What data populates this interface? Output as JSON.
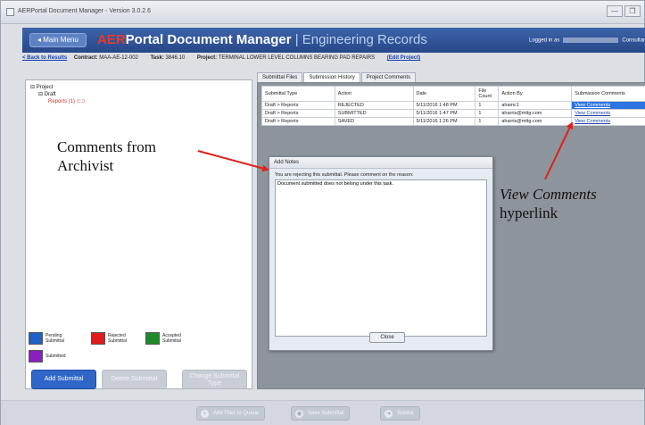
{
  "window": {
    "title": "AERPortal Document Manager - Version 3.0.2.6",
    "min_label": "—",
    "max_label": "❐"
  },
  "header": {
    "main_menu": "◂ Main Menu",
    "brand_prefix": "AER",
    "app_name": "Portal Document Manager",
    "separator": " | ",
    "section": "Engineering Records",
    "logged_in_prefix": "Logged in as",
    "role": "Consultant"
  },
  "infobar": {
    "back_link": "< Back to Results",
    "contract_label": "Contract:",
    "contract_value": "MAA-AE-12-002",
    "task_label": "Task:",
    "task_value": "3846.10",
    "project_label": "Project:",
    "project_value": "TERMINAL LOWER LEVEL COLUMNS BEARING PAD REPAIRS",
    "edit_link": "(Edit Project)"
  },
  "tree": {
    "root": "⊟ Project",
    "child": "⊟ Draft",
    "leaf": "Reports (1)"
  },
  "legend": {
    "pending": "Pending Submittal",
    "rejected": "Rejected Submittal",
    "accepted": "Accepted Submittal",
    "submitted": "Submitted",
    "colors": {
      "pending": "#1f62c6",
      "rejected": "#e01b1b",
      "accepted": "#1f8a2a",
      "submitted": "#8a1fc0"
    }
  },
  "left_buttons": {
    "add": "Add Submittal",
    "delete": "Delete Submittal",
    "change_type": "Change Submittal Type"
  },
  "tabs": [
    "Submittal Files",
    "Submission History",
    "Project Comments"
  ],
  "history": {
    "columns": [
      "Submittal Type",
      "Action",
      "Date",
      "File Count",
      "Action By",
      "Submission Comments"
    ],
    "rows": [
      {
        "type": "Draft > Reports",
        "action": "REJECTED",
        "date": "5/11/2016 1:48 PM",
        "count": "1",
        "by": "ahamc1",
        "comments": "View Comments"
      },
      {
        "type": "Draft > Reports",
        "action": "SUBMITTED",
        "date": "5/11/2016 1:47 PM",
        "count": "1",
        "by": "aharris@mttg.com",
        "comments": "View Comments"
      },
      {
        "type": "Draft > Reports",
        "action": "SAVED",
        "date": "5/11/2016 1:26 PM",
        "count": "1",
        "by": "aharris@mttg.com",
        "comments": "View Comments"
      }
    ]
  },
  "dialog": {
    "title": "Add Notes",
    "prompt": "You are rejecting this submittal. Please comment on the reason:",
    "note": "Document submitted does not belong under this task.",
    "close": "Close"
  },
  "footer": {
    "add_files": "Add Files to Queue",
    "save": "Save Submittal",
    "submit": "Submit"
  },
  "annotations": {
    "archivist_line1": "Comments from",
    "archivist_line2": "Archivist",
    "view_comments": "View Comments",
    "hyperlink": "hyperlink",
    "arrow_color": "#e0201b"
  }
}
